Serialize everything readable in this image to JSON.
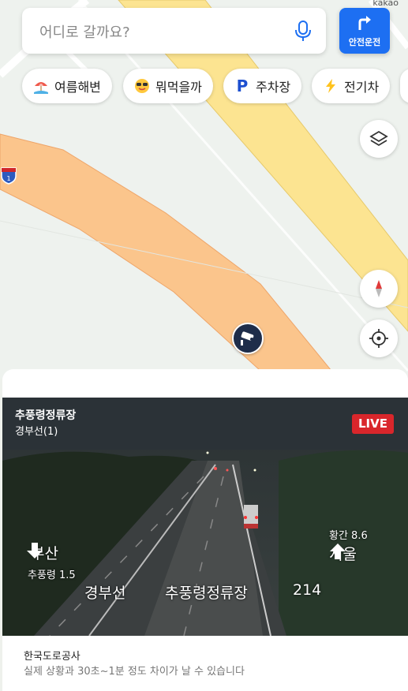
{
  "map": {
    "brand": "kakao",
    "highway_number": "1"
  },
  "search": {
    "placeholder": "어디로 갈까요?"
  },
  "safe_drive": {
    "label": "안전운전"
  },
  "chips": [
    {
      "label": "여름해변",
      "icon": "beach-umbrella-icon"
    },
    {
      "label": "뭐먹을까",
      "icon": "sunglasses-emoji-icon"
    },
    {
      "label": "주차장",
      "icon": "parking-icon"
    },
    {
      "label": "전기차",
      "icon": "lightning-icon"
    }
  ],
  "colors": {
    "accent": "#1d6ff2",
    "live": "#d9262b",
    "road_yellow": "#fce491",
    "road_orange": "#fbc58c"
  },
  "camera": {
    "name": "추풍령정류장",
    "road": "경부선(1)",
    "live": "LIVE",
    "overlay": {
      "left_dir": "부산",
      "left_sub": "추풍령 1.5",
      "right_sub": "황간 8.6",
      "right_dir": "서울",
      "road": "경부선",
      "station": "추풍령정류장",
      "number": "214"
    }
  },
  "footer": {
    "source": "한국도로공사",
    "note": "실제 상황과 30초~1분 정도 차이가 날 수 있습니다"
  }
}
